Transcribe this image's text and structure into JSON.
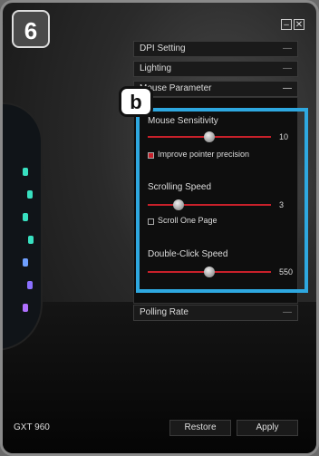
{
  "step_badges": {
    "main": "6",
    "sub": "b"
  },
  "window": {
    "minimize_icon": "minimize-icon",
    "close_icon": "close-icon"
  },
  "sections": {
    "dpi": {
      "label": "DPI Setting",
      "toggle": "—"
    },
    "lighting": {
      "label": "Lighting",
      "toggle": "—"
    },
    "mouse_param": {
      "label": "Mouse Parameter",
      "toggle": "—"
    },
    "polling": {
      "label": "Polling Rate",
      "toggle": "—"
    }
  },
  "mouse_parameter": {
    "sensitivity": {
      "label": "Mouse Sensitivity",
      "value": "10",
      "level": 0.5
    },
    "precision": {
      "label": "Improve pointer precision",
      "checked": true
    },
    "scrolling": {
      "label": "Scrolling Speed",
      "value": "3",
      "level": 0.25
    },
    "scroll_page": {
      "label": "Scroll One Page",
      "checked": false
    },
    "double_click": {
      "label": "Double-Click Speed",
      "value": "550",
      "level": 0.5
    }
  },
  "colors": {
    "highlight": "#2ea8e0",
    "slider": "#c8202a",
    "led": "#38e0c0"
  },
  "footer": {
    "model": "GXT 960",
    "restore": "Restore",
    "apply": "Apply"
  }
}
